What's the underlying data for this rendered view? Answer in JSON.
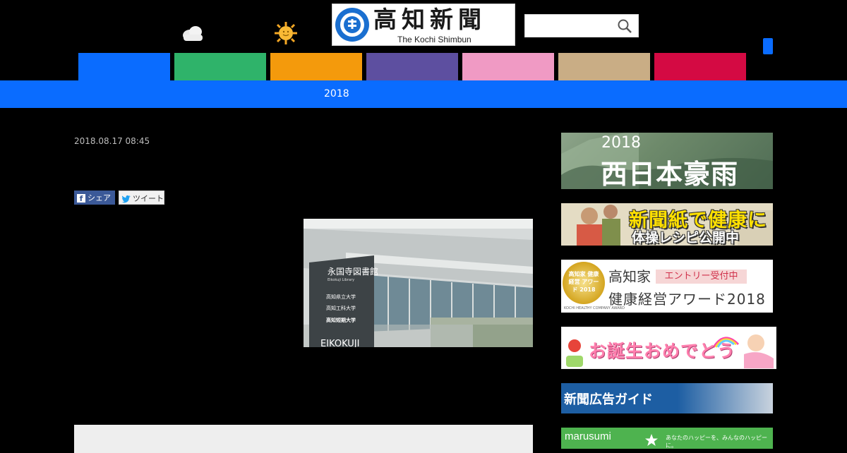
{
  "header": {
    "logo_title": "高知新聞",
    "logo_subtitle": "The Kochi Shimbun",
    "search": {
      "value": "",
      "placeholder": ""
    },
    "weather": [
      "cloud-icon",
      "sun-icon"
    ]
  },
  "nav": {
    "tabs": [
      {
        "color": "#0a6cff"
      },
      {
        "color": "#2fb36a"
      },
      {
        "color": "#f49a0c"
      },
      {
        "color": "#5d4fa0"
      },
      {
        "color": "#f09ac4"
      },
      {
        "color": "#c9ad85"
      },
      {
        "color": "#d40a43"
      }
    ],
    "active_color": "#0a6cff"
  },
  "subnav": {
    "label": "2018"
  },
  "article": {
    "date": "2018.08.17 08:45",
    "share_facebook": "シェア",
    "share_twitter": "ツイート",
    "photo": {
      "sign_title": "永国寺図書館",
      "sign_subtitle": "Eikokuji Library",
      "sign_lines": [
        "高知県立大学",
        "高知工科大学",
        "高知短期大学"
      ],
      "sign_bottom": "EIKOKUJI"
    }
  },
  "sidebar": {
    "banners": [
      {
        "id": "heavy-rain",
        "year": "2018",
        "title": "西日本豪雨"
      },
      {
        "id": "newspaper-health",
        "line1": "新聞紙で健康に",
        "line2": "体操レシピ公開中"
      },
      {
        "id": "health-award",
        "medal": "高知家 健康経営 アワード 2018",
        "title": "高知家",
        "badge": "エントリー受付中",
        "title2": "健康経営アワード2018",
        "small": "KOCHI HEALTHY COMPANY AWARD"
      },
      {
        "id": "birthday",
        "title": "お誕生おめでとう"
      },
      {
        "id": "ad-guide",
        "title": "新聞広告ガイド"
      },
      {
        "id": "marusumi",
        "title": "marusumi",
        "small": "あなたのハッピーを、みんなのハッピーに。"
      }
    ]
  }
}
